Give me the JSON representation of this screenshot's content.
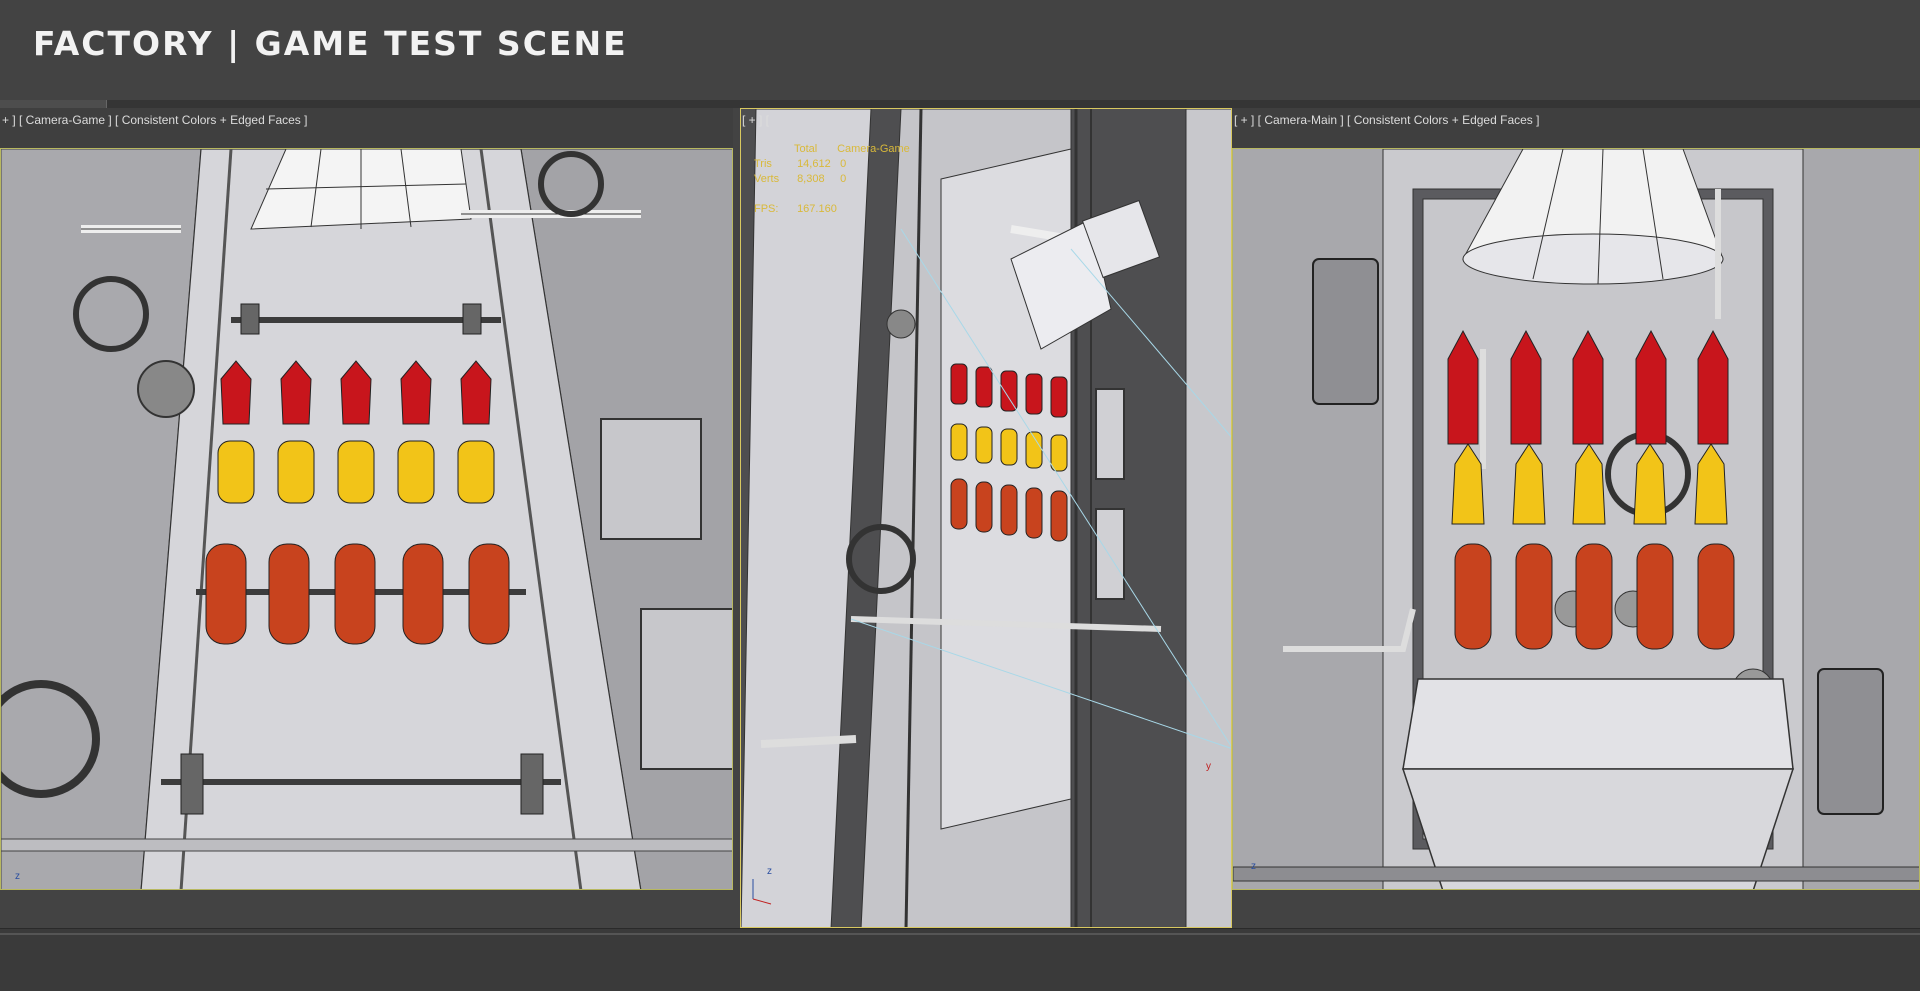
{
  "header": {
    "title": "FACTORY | GAME TEST SCENE"
  },
  "viewports": {
    "left": {
      "label": "+ ] [ Camera-Game ] [ Consistent Colors + Edged Faces ]"
    },
    "center": {
      "label": "[ + ] [",
      "stats": {
        "col_total": "Total",
        "col_camera": "Camera-Game",
        "tris_label": "Tris",
        "tris_value": "14,612",
        "tris_extra": "0",
        "verts_label": "Verts",
        "verts_value": "8,308",
        "verts_extra": "0",
        "fps_label": "FPS:",
        "fps_value": "167.160"
      }
    },
    "right": {
      "label": "[ + ] [ Camera-Main ] [ Consistent Colors + Edged Faces ]"
    }
  },
  "colors": {
    "ketchup": "#c8151c",
    "mustard": "#f2c418",
    "sausage": "#c8431e",
    "frame": "#b8b860",
    "stats_text": "#d9b93a"
  },
  "icons": [
    "axis-gizmo-icon",
    "valve-wheel-icon",
    "funnel-icon"
  ]
}
